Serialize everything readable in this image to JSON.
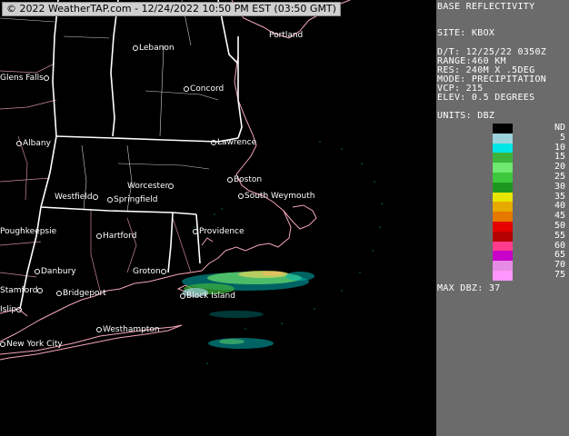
{
  "banner": "© 2022 WeatherTAP.com - 12/24/2022 10:50 PM EST (03:50 GMT)",
  "panel": {
    "title": "BASE REFLECTIVITY",
    "site": "SITE:  KBOX",
    "info": [
      "D/T:    12/25/22 0350Z",
      "RANGE:460 KM",
      "RES:   240M X .5DEG",
      "MODE:  PRECIPITATION",
      "VCP:   215",
      "ELEV:  0.5 DEGREES"
    ],
    "units": "UNITS: DBZ",
    "max": "MAX DBZ:  37"
  },
  "legend": {
    "labels": [
      "ND",
      "5",
      "10",
      "15",
      "20",
      "25",
      "30",
      "35",
      "40",
      "45",
      "50",
      "55",
      "60",
      "65",
      "70",
      "75"
    ],
    "colors": [
      "#000000",
      "#9cd2dc",
      "#00e6e6",
      "#3cb43c",
      "#6ee86e",
      "#3cc83c",
      "#1e961e",
      "#e6e600",
      "#e6aa00",
      "#e67800",
      "#e60000",
      "#b40000",
      "#ff3c8c",
      "#c800c8",
      "#e68ce6",
      "#ff96ff"
    ]
  },
  "cities": [
    {
      "name": "Lebanon"
    },
    {
      "name": "Portland"
    },
    {
      "name": "Glens Falls"
    },
    {
      "name": "Concord"
    },
    {
      "name": "Albany"
    },
    {
      "name": "Lawrence"
    },
    {
      "name": "Boston"
    },
    {
      "name": "Worcester"
    },
    {
      "name": "Westfield"
    },
    {
      "name": "Springfield"
    },
    {
      "name": "South Weymouth"
    },
    {
      "name": "Providence"
    },
    {
      "name": "Poughkeepsie"
    },
    {
      "name": "Hartford"
    },
    {
      "name": "Danbury"
    },
    {
      "name": "Groton"
    },
    {
      "name": "Block Island"
    },
    {
      "name": "Bridgeport"
    },
    {
      "name": "Westhampton"
    },
    {
      "name": "New York City"
    },
    {
      "name": "Stamford"
    },
    {
      "name": "Islip"
    }
  ]
}
